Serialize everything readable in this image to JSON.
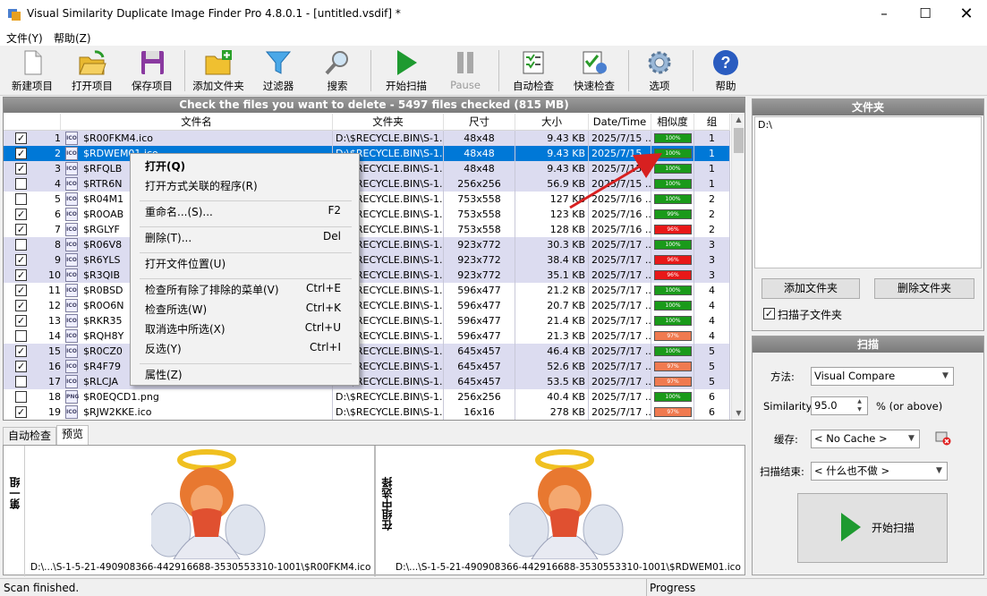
{
  "window": {
    "title": "Visual Similarity Duplicate Image Finder Pro 4.8.0.1 - [untitled.vsdif] *"
  },
  "menu": [
    "文件(Y)",
    "帮助(Z)"
  ],
  "toolbar": [
    {
      "label": "新建项目",
      "icon": "new-project-icon"
    },
    {
      "label": "打开项目",
      "icon": "open-project-icon"
    },
    {
      "label": "保存项目",
      "icon": "save-project-icon"
    },
    {
      "label": "添加文件夹",
      "icon": "add-folder-icon"
    },
    {
      "label": "过滤器",
      "icon": "filter-icon"
    },
    {
      "label": "搜索",
      "icon": "search-icon"
    },
    {
      "label": "开始扫描",
      "icon": "play-icon"
    },
    {
      "label": "Pause",
      "icon": "pause-icon"
    },
    {
      "label": "自动检查",
      "icon": "auto-check-icon"
    },
    {
      "label": "快速检查",
      "icon": "quick-check-icon"
    },
    {
      "label": "选项",
      "icon": "gear-icon"
    },
    {
      "label": "帮助",
      "icon": "help-icon"
    }
  ],
  "list": {
    "title": "Check the files you want to delete - 5497 files checked (815 MB)",
    "columns": [
      "文件名",
      "文件夹",
      "尺寸",
      "大小",
      "Date/Time",
      "相似度",
      "组"
    ],
    "rows": [
      {
        "n": "1",
        "name": "$R00FKM4.ico",
        "folder": "D:\\$RECYCLE.BIN\\S-1...",
        "dim": "48x48",
        "size": "9.43 KB",
        "date": "2025/7/15 ...",
        "sim": "100%",
        "group": "1",
        "checked": true
      },
      {
        "n": "2",
        "name": "$RDWEM01.ico",
        "folder": "D:\\$RECYCLE.BIN\\S-1...",
        "dim": "48x48",
        "size": "9.43 KB",
        "date": "2025/7/15 ...",
        "sim": "100%",
        "group": "1",
        "checked": true,
        "selected": true
      },
      {
        "n": "3",
        "name": "$RFQLB",
        "folder": "D:\\$RECYCLE.BIN\\S-1...",
        "dim": "48x48",
        "size": "9.43 KB",
        "date": "2025/7/15 ...",
        "sim": "100%",
        "group": "1",
        "checked": true
      },
      {
        "n": "4",
        "name": "$RTR6N",
        "folder": "D:\\$RECYCLE.BIN\\S-1...",
        "dim": "256x256",
        "size": "56.9 KB",
        "date": "2025/7/15 ...",
        "sim": "100%",
        "group": "1",
        "checked": false
      },
      {
        "n": "5",
        "name": "$R04M1",
        "folder": "D:\\$RECYCLE.BIN\\S-1...",
        "dim": "753x558",
        "size": "127 KB",
        "date": "2025/7/16 ...",
        "sim": "100%",
        "group": "2",
        "checked": false
      },
      {
        "n": "6",
        "name": "$R0OAB",
        "folder": "D:\\$RECYCLE.BIN\\S-1...",
        "dim": "753x558",
        "size": "123 KB",
        "date": "2025/7/16 ...",
        "sim": "99%",
        "group": "2",
        "checked": true
      },
      {
        "n": "7",
        "name": "$RGLYF",
        "folder": "D:\\$RECYCLE.BIN\\S-1...",
        "dim": "753x558",
        "size": "128 KB",
        "date": "2025/7/16 ...",
        "sim": "96%",
        "group": "2",
        "checked": true
      },
      {
        "n": "8",
        "name": "$R06V8",
        "folder": "D:\\$RECYCLE.BIN\\S-1...",
        "dim": "923x772",
        "size": "30.3 KB",
        "date": "2025/7/17 ...",
        "sim": "100%",
        "group": "3",
        "checked": false
      },
      {
        "n": "9",
        "name": "$R6YLS",
        "folder": "D:\\$RECYCLE.BIN\\S-1...",
        "dim": "923x772",
        "size": "38.4 KB",
        "date": "2025/7/17 ...",
        "sim": "96%",
        "group": "3",
        "checked": true
      },
      {
        "n": "10",
        "name": "$R3QIB",
        "folder": "D:\\$RECYCLE.BIN\\S-1...",
        "dim": "923x772",
        "size": "35.1 KB",
        "date": "2025/7/17 ...",
        "sim": "96%",
        "group": "3",
        "checked": true
      },
      {
        "n": "11",
        "name": "$R0BSD",
        "folder": "D:\\$RECYCLE.BIN\\S-1...",
        "dim": "596x477",
        "size": "21.2 KB",
        "date": "2025/7/17 ...",
        "sim": "100%",
        "group": "4",
        "checked": true
      },
      {
        "n": "12",
        "name": "$R0O6N",
        "folder": "D:\\$RECYCLE.BIN\\S-1...",
        "dim": "596x477",
        "size": "20.7 KB",
        "date": "2025/7/17 ...",
        "sim": "100%",
        "group": "4",
        "checked": true
      },
      {
        "n": "13",
        "name": "$RKR35",
        "folder": "D:\\$RECYCLE.BIN\\S-1...",
        "dim": "596x477",
        "size": "21.4 KB",
        "date": "2025/7/17 ...",
        "sim": "100%",
        "group": "4",
        "checked": true
      },
      {
        "n": "14",
        "name": "$RQH8Y",
        "folder": "D:\\$RECYCLE.BIN\\S-1...",
        "dim": "596x477",
        "size": "21.3 KB",
        "date": "2025/7/17 ...",
        "sim": "97%",
        "group": "4",
        "checked": false
      },
      {
        "n": "15",
        "name": "$R0CZ0",
        "folder": "D:\\$RECYCLE.BIN\\S-1...",
        "dim": "645x457",
        "size": "46.4 KB",
        "date": "2025/7/17 ...",
        "sim": "100%",
        "group": "5",
        "checked": true
      },
      {
        "n": "16",
        "name": "$R4F79",
        "folder": "D:\\$RECYCLE.BIN\\S-1...",
        "dim": "645x457",
        "size": "52.6 KB",
        "date": "2025/7/17 ...",
        "sim": "97%",
        "group": "5",
        "checked": true
      },
      {
        "n": "17",
        "name": "$RLCJA",
        "folder": "D:\\$RECYCLE.BIN\\S-1...",
        "dim": "645x457",
        "size": "53.5 KB",
        "date": "2025/7/17 ...",
        "sim": "97%",
        "group": "5",
        "checked": false
      },
      {
        "n": "18",
        "name": "$R0EQCD1.png",
        "folder": "D:\\$RECYCLE.BIN\\S-1...",
        "dim": "256x256",
        "size": "40.4 KB",
        "date": "2025/7/17 ...",
        "sim": "100%",
        "group": "6",
        "checked": false
      },
      {
        "n": "19",
        "name": "$RJW2KKE.ico",
        "folder": "D:\\$RECYCLE.BIN\\S-1...",
        "dim": "16x16",
        "size": "278 KB",
        "date": "2025/7/17 ...",
        "sim": "97%",
        "group": "6",
        "checked": true
      }
    ]
  },
  "context_menu": [
    {
      "label": "打开(Q)",
      "key": "",
      "bold": true
    },
    {
      "label": "打开方式关联的程序(R)",
      "key": ""
    },
    {
      "sep": true
    },
    {
      "label": "重命名...(S)...",
      "key": "F2"
    },
    {
      "sep": true
    },
    {
      "label": "删除(T)...",
      "key": "Del"
    },
    {
      "sep": true
    },
    {
      "label": "打开文件位置(U)",
      "key": ""
    },
    {
      "sep": true
    },
    {
      "label": "检查所有除了排除的菜单(V)",
      "key": "Ctrl+E"
    },
    {
      "label": "检查所选(W)",
      "key": "Ctrl+K"
    },
    {
      "label": "取消选中所选(X)",
      "key": "Ctrl+U"
    },
    {
      "label": "反选(Y)",
      "key": "Ctrl+I"
    },
    {
      "sep": true
    },
    {
      "label": "属性(Z)",
      "key": ""
    }
  ],
  "tabs": [
    "自动检查",
    "预览"
  ],
  "preview": {
    "left_label": "第一组",
    "right_label": "在组中选择",
    "left_path": "D:\\...\\S-1-5-21-490908366-442916688-3530553310-1001\\$R00FKM4.ico",
    "right_path": "D:\\...\\S-1-5-21-490908366-442916688-3530553310-1001\\$RDWEM01.ico"
  },
  "folders": {
    "title": "文件夹",
    "items": [
      "D:\\"
    ],
    "add_btn": "添加文件夹",
    "del_btn": "删除文件夹",
    "subfolders_label": "扫描子文件夹",
    "subfolders_checked": true
  },
  "scan": {
    "title": "扫描",
    "method_label": "方法:",
    "method_value": "Visual Compare",
    "similarity_label": "Similarity:",
    "similarity_value": "95.0",
    "similarity_unit": "% (or above)",
    "cache_label": "缓存:",
    "cache_value": "< No Cache >",
    "end_label": "扫描结束:",
    "end_value": "< 什么也不做 >",
    "start_btn": "开始扫描"
  },
  "status": {
    "left": "Scan finished.",
    "right": "Progress"
  },
  "colors": {
    "sim100": "#1a9a1a",
    "sim99": "#1a9a1a",
    "sim97": "#f07a50",
    "sim96": "#e81818",
    "selected": "#0078d7",
    "arrow": "#d82020"
  }
}
